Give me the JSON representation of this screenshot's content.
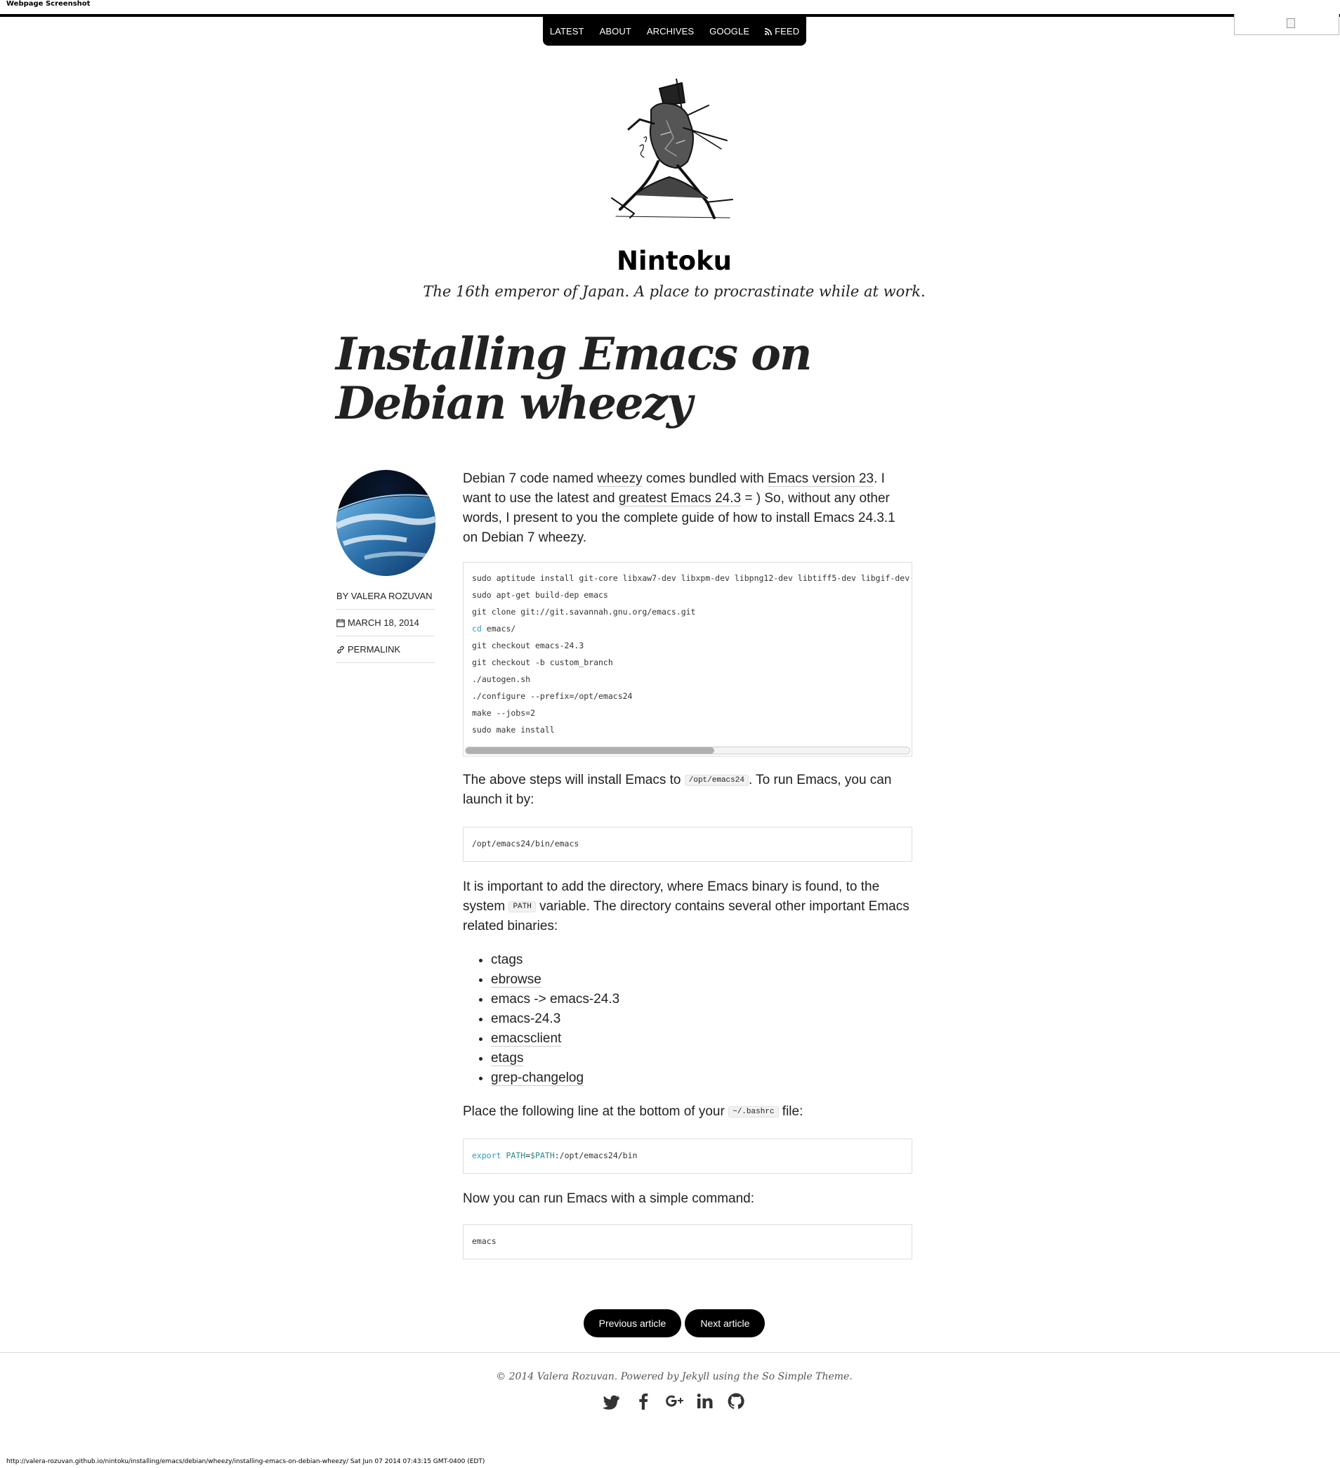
{
  "capture": {
    "label": "Webpage Screenshot",
    "footer_url": "http://valera-rozuvan.github.io/nintoku/installing/emacs/debian/wheezy/installing-emacs-on-debian-wheezy/ Sat Jun 07 2014 07:43:15 GMT-0400 (EDT)"
  },
  "nav": {
    "latest": "Latest",
    "about": "About",
    "archives": "Archives",
    "google": "Google",
    "feed": "Feed"
  },
  "site": {
    "title": "Nintoku",
    "description": "The 16th emperor of Japan. A place to procrastinate while at work."
  },
  "post": {
    "title": "Installing Emacs on Debian wheezy",
    "author": "By Valera Rozuvan",
    "date": "March 18, 2014",
    "permalink": "Permalink"
  },
  "content": {
    "intro": {
      "t1": "Debian 7 code named ",
      "link_wheezy": "wheezy",
      "t2": " comes bundled with ",
      "link_emacs23": "Emacs version 23",
      "t3": ". I want to use the latest and ",
      "link_greatest": "greatest Emacs 24.3",
      "t4": " = ) So, without any other words, I present to you the complete guide of how to install Emacs 24.3.1 on Debian 7 wheezy."
    },
    "code_install": [
      "sudo aptitude install git-core libxaw7-dev libxpm-dev libpng12-dev libtiff5-dev libgif-dev",
      "sudo apt-get build-dep emacs",
      "git clone git://git.savannah.gnu.org/emacs.git",
      "emacs/",
      "git checkout emacs-24.3",
      "git checkout -b custom_branch",
      "./autogen.sh",
      "./configure --prefix=/opt/emacs24",
      "make --jobs=2",
      "sudo make install"
    ],
    "code_cd_keyword": "cd",
    "p2": {
      "t1": "The above steps will install Emacs to ",
      "code": "/opt/emacs24",
      "t2": ". To run Emacs, you can launch it by:"
    },
    "code_run": "/opt/emacs24/bin/emacs",
    "p3": {
      "t1": "It is important to add the directory, where Emacs binary is found, to the system ",
      "code": "PATH",
      "t2": " variable. The directory contains several other important Emacs related binaries:"
    },
    "binaries": [
      "ctags",
      "ebrowse",
      "emacs -> emacs-24.3",
      "emacs-24.3",
      "emacsclient",
      "etags",
      "grep-changelog"
    ],
    "p4": {
      "t1": "Place the following line at the bottom of your ",
      "code": "~/.bashrc",
      "t2": " file:"
    },
    "code_export": {
      "kw": "export",
      "var": "PATH",
      "eq": "=",
      "ref": "$PATH",
      "rest": ":/opt/emacs24/bin"
    },
    "p5": "Now you can run Emacs with a simple command:",
    "code_cmd": "emacs"
  },
  "pager": {
    "previous": "Previous article",
    "next": "Next article"
  },
  "footer": {
    "t1": "© 2014 Valera Rozuvan. Powered by ",
    "jekyll": "Jekyll",
    "t2": " using the ",
    "theme": "So Simple Theme",
    "t3": ".",
    "social": [
      "twitter-icon",
      "facebook-icon",
      "google-plus-icon",
      "linkedin-icon",
      "github-icon"
    ]
  }
}
